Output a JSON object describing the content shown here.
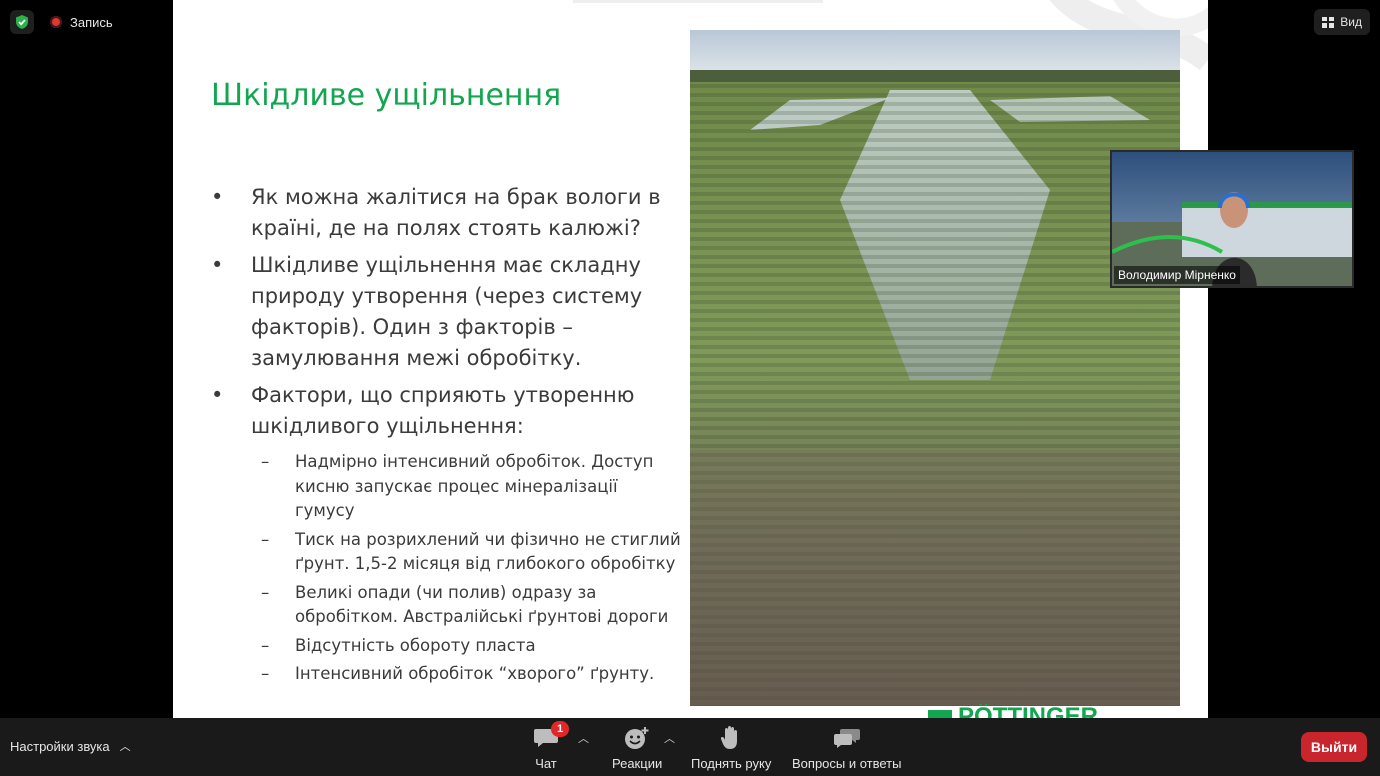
{
  "top": {
    "record_label": "Запись",
    "view_label": "Вид"
  },
  "slide": {
    "title": "Шкідливе ущільнення",
    "bullets": [
      "Як можна жалітися на брак вологи в країні, де на полях стоять калюжі?",
      "Шкідливе ущільнення має складну природу утворення (через систему факторів). Один з факторів – замулювання межі обробітку.",
      "Фактори, що сприяють утворенню шкідливого ущільнення:"
    ],
    "sub_bullets": [
      "Надмірно інтенсивний обробіток. Доступ кисню запускає процес мінералізації гумусу",
      "Тиск на розрихлений чи фізично не стиглий ґрунт. 1,5-2 місяця від глибокого обробітку",
      "Великі опади (чи полив) одразу за обробітком. Австралійські ґрунтові дороги",
      "Відсутність обороту пласта",
      "Інтенсивний обробіток “хворого” ґрунту."
    ],
    "logo_text": "PÖTTINGER"
  },
  "video": {
    "participant_name": "Володимир Мірненко"
  },
  "toolbar": {
    "audio_settings": "Настройки звука",
    "chat": "Чат",
    "chat_badge": "1",
    "reactions": "Реакции",
    "raise_hand": "Поднять руку",
    "qa": "Вопросы и ответы",
    "leave": "Выйти"
  },
  "colors": {
    "title_green": "#13a650",
    "leave_red": "#c9252c",
    "badge_red": "#e02828"
  }
}
